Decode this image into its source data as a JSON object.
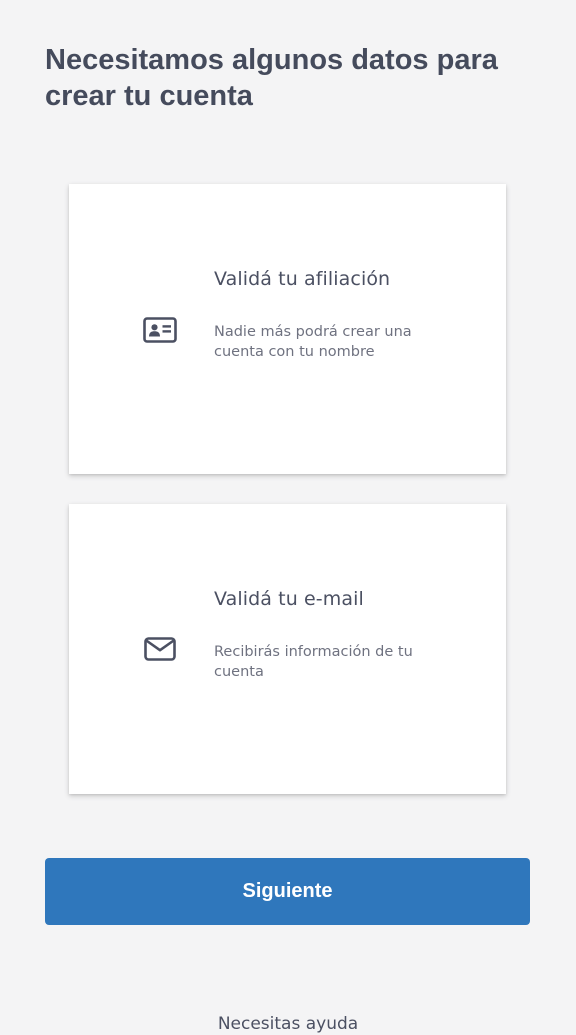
{
  "header": {
    "title": "Necesitamos algunos datos para crear tu cuenta"
  },
  "cards": [
    {
      "icon": "id-card-icon",
      "title": "Validá tu afiliación",
      "description": "Nadie más podrá crear una cuenta con tu nombre"
    },
    {
      "icon": "envelope-icon",
      "title": "Validá tu e-mail",
      "description": "Recibirás información de tu cuenta"
    }
  ],
  "actions": {
    "next_label": "Siguiente"
  },
  "footer": {
    "help_text": "Necesitas ayuda"
  },
  "colors": {
    "background": "#f4f4f5",
    "title_text": "#454b5c",
    "primary_button": "#2f77bc",
    "icon": "#4b5062"
  }
}
